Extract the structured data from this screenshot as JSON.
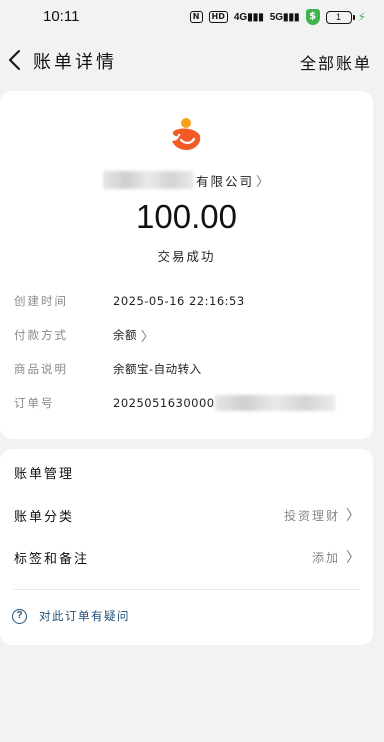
{
  "status_bar": {
    "time": "10:11",
    "nfc": "N",
    "hd": "HD",
    "sig1": "4G",
    "sig2": "5G",
    "shield": "$",
    "battery": "1"
  },
  "header": {
    "title": "账单详情",
    "right_link": "全部账单"
  },
  "transaction": {
    "merchant_suffix": "有限公司",
    "amount": "100.00",
    "status": "交易成功"
  },
  "details": {
    "created_label": "创建时间",
    "created_value": "2025-05-16 22:16:53",
    "payment_label": "付款方式",
    "payment_value": "余额",
    "desc_label": "商品说明",
    "desc_value": "余额宝-自动转入",
    "order_label": "订单号",
    "order_value": "2025051630000"
  },
  "management": {
    "title": "账单管理",
    "category_label": "账单分类",
    "category_value": "投资理财",
    "tags_label": "标签和备注",
    "tags_value": "添加",
    "help_text": "对此订单有疑问"
  },
  "colors": {
    "brand_orange": "#f25a26",
    "brand_yellow": "#f7a21b",
    "link_blue": "#1f4e79",
    "shield_green": "#3cb54a"
  },
  "icons": {
    "back": "back-arrow-icon",
    "chevron": "chevron-right-icon",
    "help": "question-circle-icon",
    "logo": "yuebao-fish-logo"
  }
}
